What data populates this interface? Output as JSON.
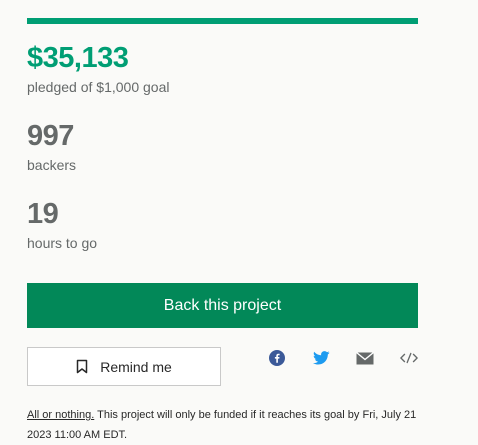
{
  "campaign": {
    "progress_fraction": 1.0,
    "pledged_amount": "$35,133",
    "pledged_label": "pledged of $1,000 goal",
    "backers_count": "997",
    "backers_label": "backers",
    "hours_count": "19",
    "hours_label": "hours to go"
  },
  "actions": {
    "back_label": "Back this project",
    "remind_label": "Remind me"
  },
  "share": {
    "icons": [
      "facebook-icon",
      "twitter-icon",
      "email-icon",
      "embed-icon"
    ]
  },
  "footnote": {
    "link_text": "All or nothing.",
    "text": " This project will only be funded if it reaches its goal by Fri, July 21 2023 11:00 AM EDT."
  },
  "colors": {
    "accent": "#009e74",
    "button": "#028858",
    "icon_blue": "#1d9bf0",
    "icon_dark_blue": "#3b5998"
  }
}
